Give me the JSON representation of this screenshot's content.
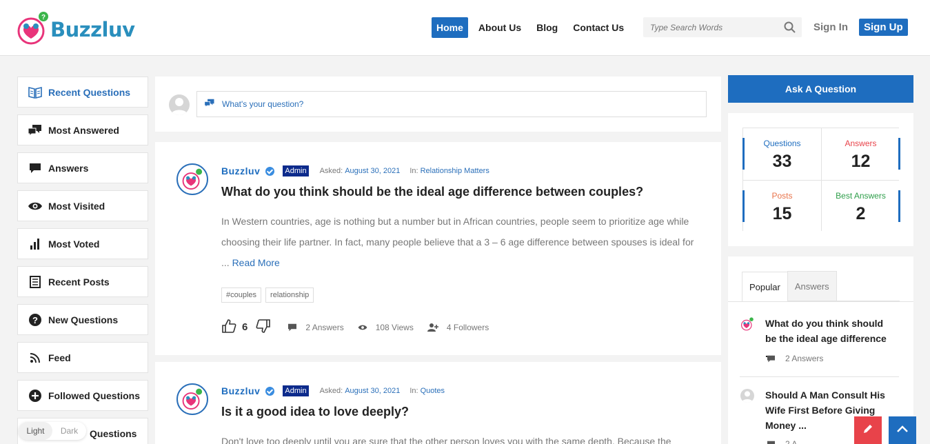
{
  "header": {
    "brand": "Buzzluv",
    "nav": [
      {
        "label": "Home",
        "active": true
      },
      {
        "label": "About Us",
        "active": false
      },
      {
        "label": "Blog",
        "active": false
      },
      {
        "label": "Contact Us",
        "active": false
      }
    ],
    "search_placeholder": "Type Search Words",
    "signin_label": "Sign In",
    "signup_label": "Sign Up"
  },
  "colors": {
    "accent": "#1e6dbf",
    "brand": "#2a8fbd",
    "danger": "#e8434a"
  },
  "left_nav": [
    {
      "label": "Recent Questions",
      "icon": "book-open-icon",
      "active": true
    },
    {
      "label": "Most Answered",
      "icon": "chat-bubbles-icon",
      "active": false
    },
    {
      "label": "Answers",
      "icon": "chat-bubble-icon",
      "active": false
    },
    {
      "label": "Most Visited",
      "icon": "eye-icon",
      "active": false
    },
    {
      "label": "Most Voted",
      "icon": "bar-chart-icon",
      "active": false
    },
    {
      "label": "Recent Posts",
      "icon": "document-icon",
      "active": false
    },
    {
      "label": "New Questions",
      "icon": "question-circle-icon",
      "active": false
    },
    {
      "label": "Feed",
      "icon": "rss-icon",
      "active": false
    },
    {
      "label": "Followed Questions",
      "icon": "plus-circle-icon",
      "active": false
    },
    {
      "label": "Questions",
      "icon": "question-icon",
      "active": false
    }
  ],
  "ask": {
    "placeholder": "What's your question?"
  },
  "questions": [
    {
      "author": "Buzzluv",
      "badge": "Admin",
      "asked_label": "Asked:",
      "date": "August 30, 2021",
      "in_label": "In:",
      "category": "Relationship Matters",
      "title": "What do you think should be the ideal age difference between couples?",
      "excerpt": "In Western countries, age is nothing but a number but in African countries, people seem to prioritize age while choosing their life partner. In fact, many people believe that a 3 – 6 age difference between spouses is ideal for ...",
      "read_more": "Read More",
      "tags": [
        "#couples",
        "relationship"
      ],
      "votes": "6",
      "answers": "2 Answers",
      "views": "108 Views",
      "followers": "4 Followers"
    },
    {
      "author": "Buzzluv",
      "badge": "Admin",
      "asked_label": "Asked:",
      "date": "August 30, 2021",
      "in_label": "In:",
      "category": "Quotes",
      "title": "Is it a good idea to love deeply?",
      "excerpt": "Don't love too deeply until you are sure that the other person loves you with the same depth. Because the"
    }
  ],
  "right": {
    "ask_button": "Ask A Question",
    "stats": [
      {
        "label": "Questions",
        "value": "33",
        "color": "#1e6dbf"
      },
      {
        "label": "Answers",
        "value": "12",
        "color": "#e8434a"
      },
      {
        "label": "Posts",
        "value": "15",
        "color": "#e8734a"
      },
      {
        "label": "Best Answers",
        "value": "2",
        "color": "#2e9e4a"
      }
    ],
    "tabs": [
      {
        "label": "Popular",
        "active": true
      },
      {
        "label": "Answers",
        "active": false
      }
    ],
    "popular": [
      {
        "title": "What do you think should be the ideal age difference ...",
        "answers": "2 Answers"
      },
      {
        "title": "Should A Man Consult His Wife First Before Giving Money ...",
        "answers": "2 A"
      }
    ]
  },
  "theme": {
    "light": "Light",
    "dark": "Dark"
  }
}
